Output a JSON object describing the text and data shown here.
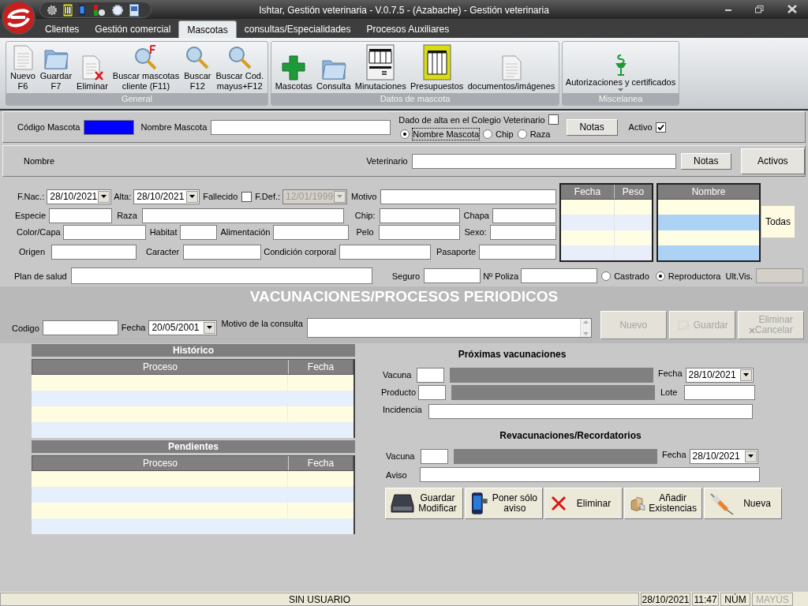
{
  "window": {
    "title": "Ishtar, Gestión veterinaria - V.0.7.5 - (Azabache) - Gestión veterinaria"
  },
  "tabs": [
    {
      "label": "Clientes",
      "selected": false
    },
    {
      "label": "Gestión comercial",
      "selected": false
    },
    {
      "label": "Mascotas",
      "selected": true
    },
    {
      "label": "consultas/Especialidades",
      "selected": false
    },
    {
      "label": "Procesos Auxiliares",
      "selected": false
    }
  ],
  "ribbon": [
    {
      "title": "General",
      "buttons": [
        {
          "lines": [
            "Nuevo",
            "F6"
          ]
        },
        {
          "lines": [
            "Guardar",
            "F7"
          ]
        },
        {
          "lines": [
            "Eliminar"
          ]
        },
        {
          "lines": [
            "Buscar mascotas",
            "cliente (F11)"
          ]
        },
        {
          "lines": [
            "Buscar",
            "F12"
          ]
        },
        {
          "lines": [
            "Buscar Cod.",
            "mayus+F12"
          ]
        }
      ]
    },
    {
      "title": "Datos de mascota",
      "buttons": [
        {
          "lines": [
            "Mascotas"
          ]
        },
        {
          "lines": [
            "Consulta"
          ]
        },
        {
          "lines": [
            "Minutaciones"
          ]
        },
        {
          "lines": [
            "Presupuestos"
          ]
        },
        {
          "lines": [
            "documentos/imágenes"
          ]
        }
      ]
    },
    {
      "title": "Miscelanea",
      "buttons": [
        {
          "lines": [
            "Autorizaciones y certificados"
          ],
          "dropdown": true
        }
      ]
    }
  ],
  "pet_header": {
    "codigo_label": "Código Mascota",
    "nombre_label": "Nombre Mascota",
    "colegio_label": "Dado de alta en el Colegio Veterinario",
    "colegio_checked": false,
    "notas_button": "Notas",
    "activo_label": "Activo",
    "activo_checked": true,
    "search_by": [
      {
        "label": "Nombre Mascota",
        "selected": true
      },
      {
        "label": "Chip",
        "selected": false
      },
      {
        "label": "Raza",
        "selected": false
      }
    ]
  },
  "owner_bar": {
    "nombre_label": "Nombre",
    "veterinario_label": "Veterinario",
    "notas_button": "Notas",
    "activos_button": "Activos"
  },
  "details": {
    "fnac": {
      "label": "F.Nac.:",
      "value": "28/10/2021"
    },
    "alta": {
      "label": "Alta:",
      "value": "28/10/2021"
    },
    "fallecido": {
      "label": "Fallecido",
      "checked": false
    },
    "fdef": {
      "label": "F.Def.:",
      "value": "12/01/1999",
      "disabled": true
    },
    "motivo_label": "Motivo",
    "especie_label": "Especie",
    "raza_label": "Raza",
    "chip_label": "Chip:",
    "chapa_label": "Chapa",
    "color_label": "Color/Capa",
    "habitat_label": "Habitat",
    "alimentacion_label": "Alimentación",
    "pelo_label": "Pelo",
    "sexo_label": "Sexo:",
    "origen_label": "Origen",
    "caracter_label": "Caracter",
    "condicion_label": "Condición corporal",
    "pasaporte_label": "Pasaporte",
    "plan_label": "Plan de salud",
    "seguro_label": "Seguro",
    "poliza_label": "Nº Poliza",
    "status": [
      {
        "label": "Castrado",
        "selected": false
      },
      {
        "label": "Reproductora",
        "selected": true
      }
    ],
    "ult_vis_label": "Ult.Vis.",
    "weight_table": {
      "columns": [
        "Fecha",
        "Peso"
      ]
    },
    "names_table": {
      "columns": [
        "Nombre"
      ]
    },
    "todas_button": "Todas"
  },
  "vaccinations": {
    "title": "VACUNACIONES/PROCESOS PERIODICOS",
    "codigo_label": "Codigo",
    "fecha": {
      "label": "Fecha",
      "value": "20/05/2001"
    },
    "motivo_label": "Motivo de la consulta",
    "actions": [
      {
        "lines": [
          "Nuevo"
        ],
        "disabled": true
      },
      {
        "lines": [
          "Guardar"
        ],
        "disabled": true
      },
      {
        "lines": [
          "Eliminar",
          "Cancelar"
        ],
        "disabled": true
      }
    ]
  },
  "historico": {
    "title": "Histórico",
    "columns": [
      "Proceso",
      "Fecha"
    ]
  },
  "pendientes": {
    "title": "Pendientes",
    "columns": [
      "Proceso",
      "Fecha"
    ]
  },
  "proximas": {
    "title": "Próximas vacunaciones",
    "vacuna_label": "Vacuna",
    "fecha": {
      "label": "Fecha",
      "value": "28/10/2021"
    },
    "producto_label": "Producto",
    "lote_label": "Lote",
    "incidencia_label": "Incidencia"
  },
  "revacunaciones": {
    "title": "Revacunaciones/Recordatorios",
    "vacuna_label": "Vacuna",
    "fecha": {
      "label": "Fecha",
      "value": "28/10/2021"
    },
    "aviso_label": "Aviso"
  },
  "bottom_buttons": [
    {
      "lines": [
        "Guardar",
        "Modificar"
      ]
    },
    {
      "lines": [
        "Poner sólo",
        "aviso"
      ]
    },
    {
      "lines": [
        "Eliminar"
      ]
    },
    {
      "lines": [
        "Añadir",
        "Existencias"
      ]
    },
    {
      "lines": [
        "Nueva"
      ]
    }
  ],
  "status_bar": {
    "user": "SIN USUARIO",
    "date": "28/10/2021",
    "time": "11:47",
    "indicators": [
      {
        "label": "NÚM",
        "on": true
      },
      {
        "label": "MAYÚS",
        "on": false
      }
    ]
  }
}
